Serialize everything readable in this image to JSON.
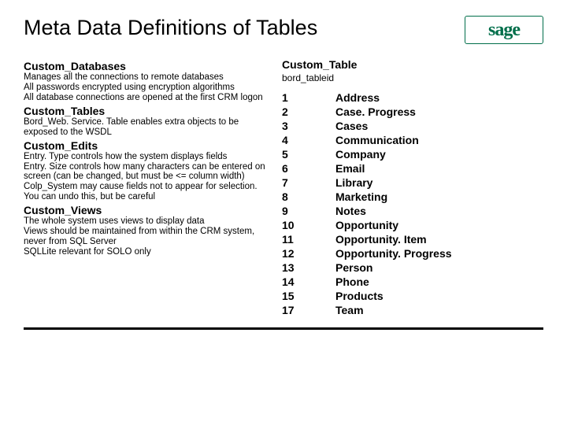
{
  "title": "Meta Data Definitions of Tables",
  "logo_text": "sage",
  "left": {
    "sections": [
      {
        "heading": "Custom_Databases",
        "lines": [
          "Manages all the connections to remote databases",
          "All passwords encrypted using encryption algorithms",
          "All database connections are opened at the first CRM logon"
        ]
      },
      {
        "heading": "Custom_Tables",
        "lines": [
          "Bord_Web. Service. Table enables extra objects to be exposed to the WSDL"
        ]
      },
      {
        "heading": "Custom_Edits",
        "lines": [
          "Entry. Type controls how the system displays fields",
          "Entry. Size controls how many characters can be entered on screen (can be changed, but must be <= column width)",
          "Colp_System may cause fields not to appear for selection. You can undo this, but be careful"
        ]
      },
      {
        "heading": "Custom_Views",
        "lines": [
          "The whole system uses views to display data",
          "Views should be maintained from within the CRM system, never from SQL Server",
          "SQLLite relevant for SOLO only"
        ]
      }
    ]
  },
  "right": {
    "heading": "Custom_Table",
    "sub": "bord_tableid",
    "rows": [
      {
        "id": "1",
        "name": "Address"
      },
      {
        "id": "2",
        "name": "Case. Progress"
      },
      {
        "id": "3",
        "name": "Cases"
      },
      {
        "id": "4",
        "name": "Communication"
      },
      {
        "id": "5",
        "name": "Company"
      },
      {
        "id": "6",
        "name": "Email"
      },
      {
        "id": "7",
        "name": "Library"
      },
      {
        "id": "8",
        "name": "Marketing"
      },
      {
        "id": "9",
        "name": "Notes"
      },
      {
        "id": "10",
        "name": "Opportunity"
      },
      {
        "id": "11",
        "name": "Opportunity. Item"
      },
      {
        "id": "12",
        "name": "Opportunity. Progress"
      },
      {
        "id": "13",
        "name": "Person"
      },
      {
        "id": "14",
        "name": "Phone"
      },
      {
        "id": "15",
        "name": "Products"
      },
      {
        "id": "17",
        "name": "Team"
      }
    ]
  }
}
